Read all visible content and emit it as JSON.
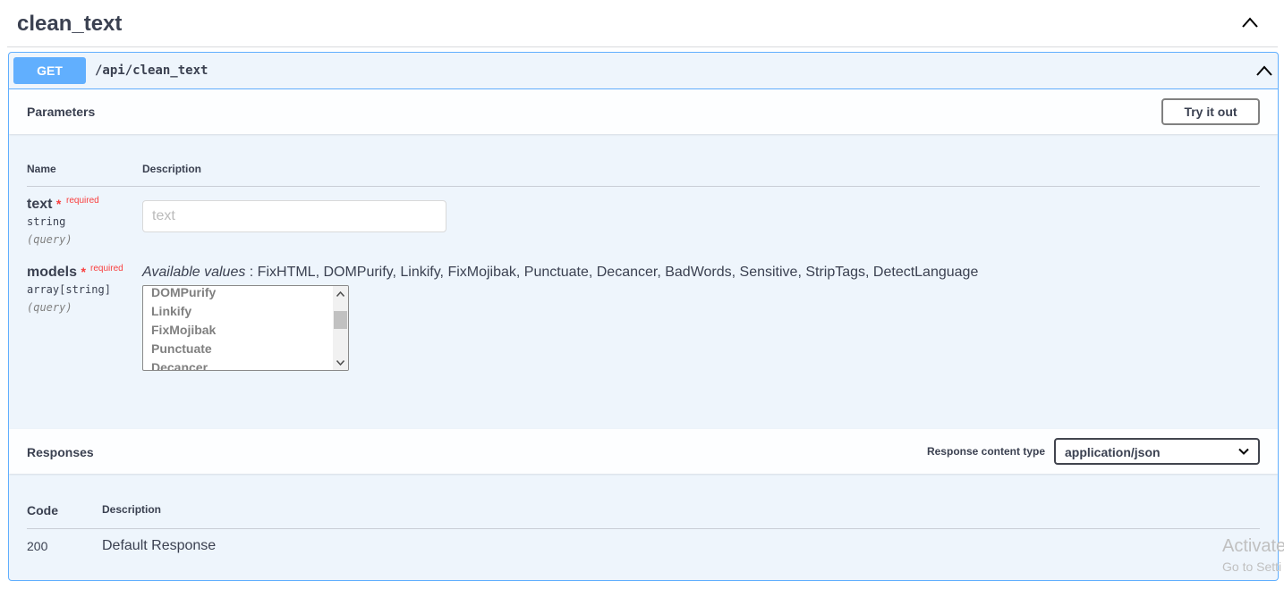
{
  "tag": {
    "title": "clean_text",
    "toggle_icon": "chevron-up-icon"
  },
  "operation": {
    "method": "GET",
    "path": "/api/clean_text",
    "color": "#61affe",
    "toggle_icon": "chevron-up-icon"
  },
  "parameters": {
    "title": "Parameters",
    "try_button": "Try it out",
    "col_name": "Name",
    "col_description": "Description",
    "items": [
      {
        "name": "text",
        "star": "*",
        "required": "required",
        "type": "string",
        "in": "(query)",
        "placeholder": "text"
      },
      {
        "name": "models",
        "star": "*",
        "required": "required",
        "type": "array[string]",
        "in": "(query)",
        "available_label": "Available values",
        "available_values": " : FixHTML, DOMPurify, Linkify, FixMojibak, Punctuate, Decancer, BadWords, Sensitive, StripTags, DetectLanguage",
        "options": [
          "DOMPurify",
          "Linkify",
          "FixMojibak",
          "Punctuate",
          "Decancer"
        ]
      }
    ]
  },
  "responses": {
    "title": "Responses",
    "content_type_label": "Response content type",
    "content_type_value": "application/json",
    "col_code": "Code",
    "col_description": "Description",
    "rows": [
      {
        "code": "200",
        "description": "Default Response"
      }
    ]
  },
  "watermark": {
    "line1": "Activate",
    "line2": "Go to Setti"
  }
}
